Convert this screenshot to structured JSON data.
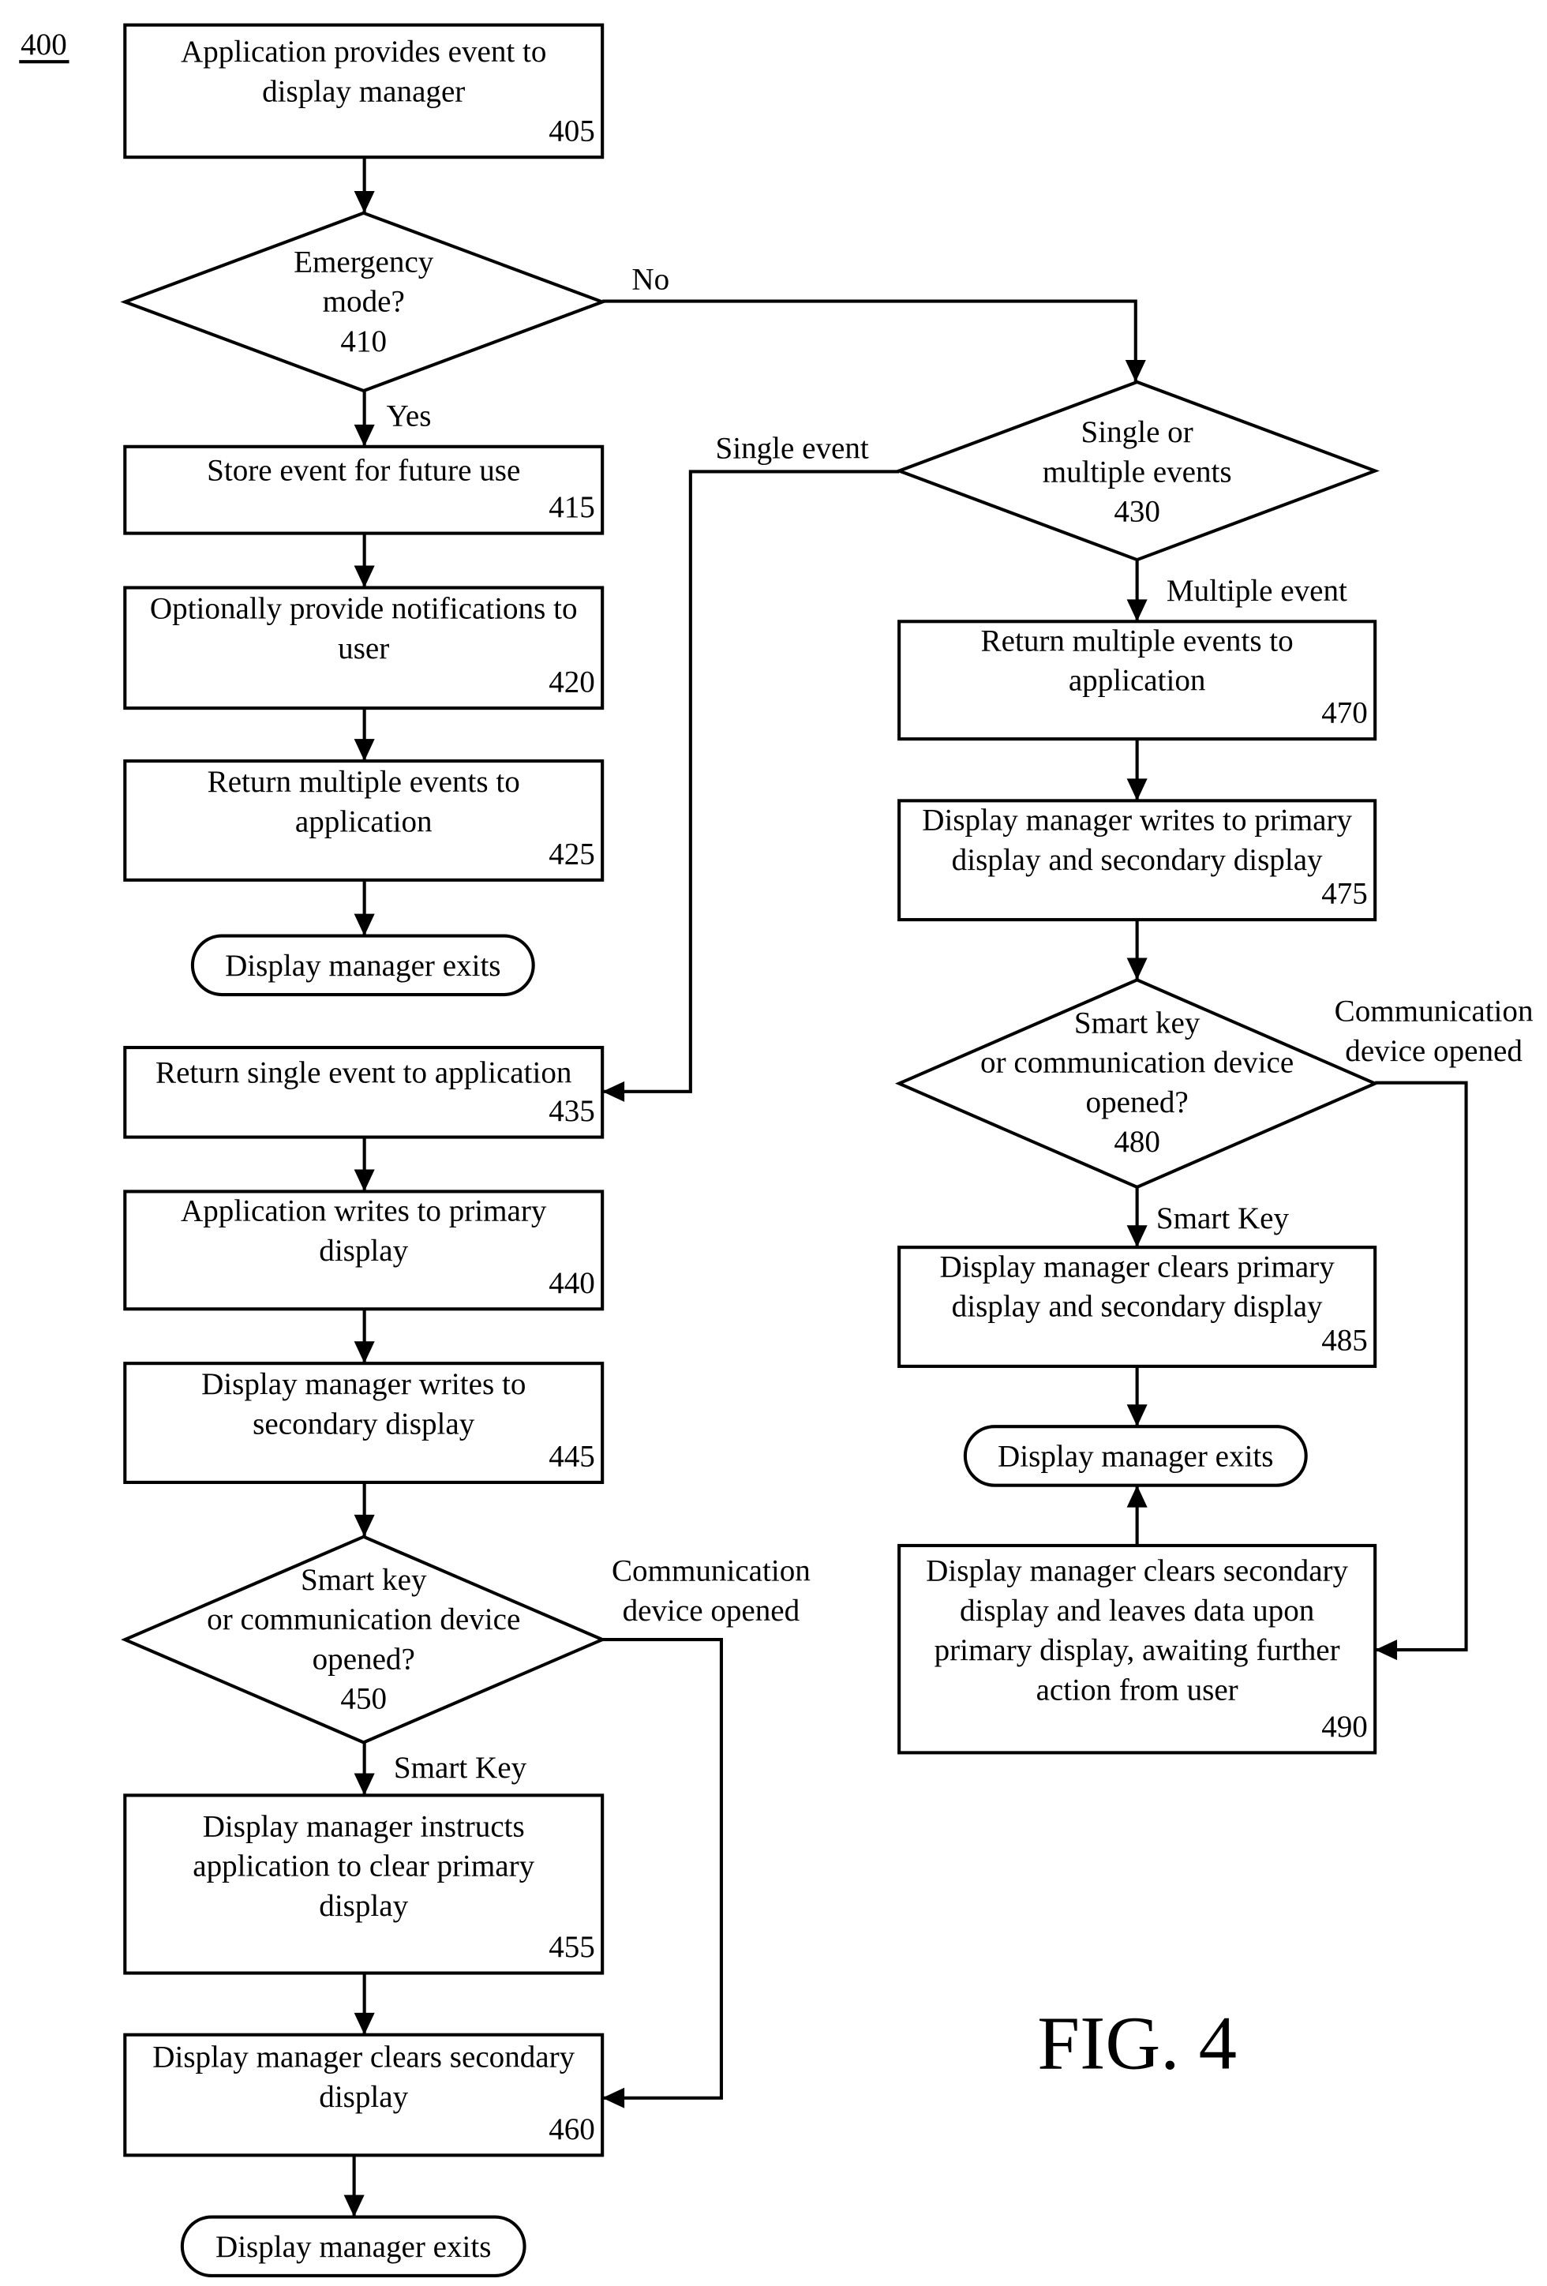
{
  "figure": {
    "number_label": "400",
    "caption": "FIG. 4"
  },
  "colors": {
    "ink": "#000000",
    "paper": "#ffffff"
  },
  "nodes": {
    "n405": {
      "type": "process",
      "lines": [
        "Application provides event to",
        "display manager"
      ],
      "ref": "405"
    },
    "n410": {
      "type": "decision",
      "lines": [
        "Emergency",
        "mode?"
      ],
      "ref": "410"
    },
    "n415": {
      "type": "process",
      "lines": [
        "Store event for future use"
      ],
      "ref": "415"
    },
    "n420": {
      "type": "process",
      "lines": [
        "Optionally provide notifications to",
        "user"
      ],
      "ref": "420"
    },
    "n425": {
      "type": "process",
      "lines": [
        "Return multiple events to",
        "application"
      ],
      "ref": "425"
    },
    "end1": {
      "type": "terminal",
      "lines": [
        "Display manager exits"
      ]
    },
    "n430": {
      "type": "decision",
      "lines": [
        "Single or",
        "multiple events"
      ],
      "ref": "430"
    },
    "n435": {
      "type": "process",
      "lines": [
        "Return single event to application"
      ],
      "ref": "435"
    },
    "n440": {
      "type": "process",
      "lines": [
        "Application writes to primary",
        "display"
      ],
      "ref": "440"
    },
    "n445": {
      "type": "process",
      "lines": [
        "Display manager writes to",
        "secondary display"
      ],
      "ref": "445"
    },
    "n450": {
      "type": "decision",
      "lines": [
        "Smart key",
        "or communication device",
        "opened?"
      ],
      "ref": "450"
    },
    "n455": {
      "type": "process",
      "lines": [
        "Display manager instructs",
        "application to clear primary",
        "display"
      ],
      "ref": "455"
    },
    "n460": {
      "type": "process",
      "lines": [
        "Display manager clears secondary",
        "display"
      ],
      "ref": "460"
    },
    "end2": {
      "type": "terminal",
      "lines": [
        "Display manager exits"
      ]
    },
    "n470": {
      "type": "process",
      "lines": [
        "Return multiple events to",
        "application"
      ],
      "ref": "470"
    },
    "n475": {
      "type": "process",
      "lines": [
        "Display manager writes to primary",
        "display and secondary display"
      ],
      "ref": "475"
    },
    "n480": {
      "type": "decision",
      "lines": [
        "Smart key",
        "or communication device",
        "opened?"
      ],
      "ref": "480"
    },
    "n485": {
      "type": "process",
      "lines": [
        "Display manager clears primary",
        "display and secondary display"
      ],
      "ref": "485"
    },
    "end3": {
      "type": "terminal",
      "lines": [
        "Display manager exits"
      ]
    },
    "n490": {
      "type": "process",
      "lines": [
        "Display manager clears secondary",
        "display and leaves data upon",
        "primary display, awaiting further",
        "action from user"
      ],
      "ref": "490"
    }
  },
  "edge_labels": {
    "no": [
      "No"
    ],
    "yes": [
      "Yes"
    ],
    "single_event": [
      "Single event"
    ],
    "multiple_event": [
      "Multiple event"
    ],
    "comm_opened_450": [
      "Communication",
      "device opened"
    ],
    "smart_key_450": [
      "Smart Key"
    ],
    "comm_opened_480": [
      "Communication",
      "device opened"
    ],
    "smart_key_480": [
      "Smart Key"
    ]
  },
  "edges": [
    {
      "from": "n405",
      "to": "n410"
    },
    {
      "from": "n410",
      "to": "n415",
      "label": "Yes"
    },
    {
      "from": "n410",
      "to": "n430",
      "label": "No"
    },
    {
      "from": "n415",
      "to": "n420"
    },
    {
      "from": "n420",
      "to": "n425"
    },
    {
      "from": "n425",
      "to": "end1"
    },
    {
      "from": "n430",
      "to": "n435",
      "label": "Single event"
    },
    {
      "from": "n430",
      "to": "n470",
      "label": "Multiple event"
    },
    {
      "from": "n435",
      "to": "n440"
    },
    {
      "from": "n440",
      "to": "n445"
    },
    {
      "from": "n445",
      "to": "n450"
    },
    {
      "from": "n450",
      "to": "n455",
      "label": "Smart Key"
    },
    {
      "from": "n450",
      "to": "n460",
      "label": "Communication device opened"
    },
    {
      "from": "n455",
      "to": "n460"
    },
    {
      "from": "n460",
      "to": "end2"
    },
    {
      "from": "n470",
      "to": "n475"
    },
    {
      "from": "n475",
      "to": "n480"
    },
    {
      "from": "n480",
      "to": "n485",
      "label": "Smart Key"
    },
    {
      "from": "n480",
      "to": "n490",
      "label": "Communication device opened"
    },
    {
      "from": "n485",
      "to": "end3"
    },
    {
      "from": "n490",
      "to": "end3"
    }
  ]
}
